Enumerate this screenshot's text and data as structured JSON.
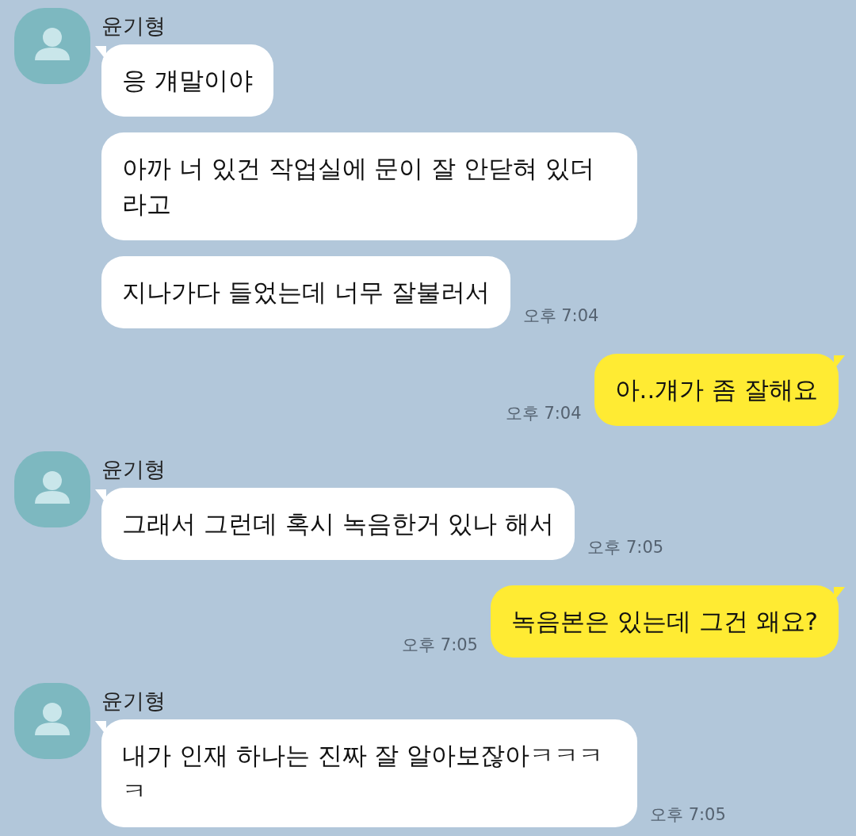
{
  "chat": [
    {
      "kind": "received",
      "sender": "윤기형",
      "messages": [
        {
          "text": "응 걔말이야"
        },
        {
          "text": "아까 너 있건 작업실에 문이 잘 안닫혀 있더라고"
        },
        {
          "text": "지나가다 들었는데 너무 잘불러서",
          "time": "오후 7:04"
        }
      ]
    },
    {
      "kind": "sent",
      "messages": [
        {
          "text": "아..걔가 좀 잘해요",
          "time": "오후 7:04"
        }
      ]
    },
    {
      "kind": "received",
      "sender": "윤기형",
      "messages": [
        {
          "text": "그래서 그런데 혹시 녹음한거 있나 해서",
          "time": "오후 7:05"
        }
      ]
    },
    {
      "kind": "sent",
      "messages": [
        {
          "text": "녹음본은 있는데 그건 왜요?",
          "time": "오후 7:05"
        }
      ]
    },
    {
      "kind": "received",
      "sender": "윤기형",
      "messages": [
        {
          "text": "내가 인재 하나는 진짜 잘 알아보잖아ㅋㅋㅋㅋ",
          "time": "오후 7:05"
        }
      ]
    }
  ]
}
